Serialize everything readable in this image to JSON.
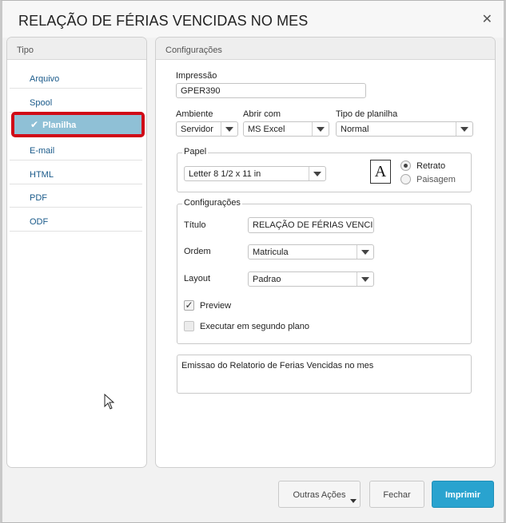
{
  "dialog": {
    "title": "RELAÇÃO DE FÉRIAS VENCIDAS NO MES",
    "close_icon": "close-icon"
  },
  "tipo": {
    "header": "Tipo",
    "items": [
      {
        "label": "Arquivo",
        "selected": false
      },
      {
        "label": "Spool",
        "selected": false
      },
      {
        "label": "Planilha",
        "selected": true
      },
      {
        "label": "E-mail",
        "selected": false
      },
      {
        "label": "HTML",
        "selected": false
      },
      {
        "label": "PDF",
        "selected": false
      },
      {
        "label": "ODF",
        "selected": false
      }
    ],
    "check_glyph": "✔"
  },
  "config": {
    "header": "Configurações",
    "impressao_label": "Impressão",
    "impressao_value": "GPER390",
    "ambiente_label": "Ambiente",
    "ambiente_value": "Servidor",
    "abrir_label": "Abrir com",
    "abrir_value": "MS Excel",
    "tipo_planilha_label": "Tipo de planilha",
    "tipo_planilha_value": "Normal",
    "papel": {
      "legend": "Papel",
      "size_value": "Letter 8 1/2 x 11 in",
      "orientation_icon_letter": "A",
      "retrato_label": "Retrato",
      "paisagem_label": "Paisagem",
      "selected": "Retrato"
    },
    "sub": {
      "legend": "Configurações",
      "titulo_label": "Título",
      "titulo_value": "RELAÇÃO DE FÉRIAS VENCIDA",
      "ordem_label": "Ordem",
      "ordem_value": "Matricula",
      "layout_label": "Layout",
      "layout_value": "Padrao",
      "preview_label": "Preview",
      "preview_checked": true,
      "segundo_plano_label": "Executar em segundo plano",
      "segundo_plano_checked": false
    },
    "description": "Emissao do Relatorio de Ferias Vencidas no mes"
  },
  "footer": {
    "outras_acoes": "Outras Ações",
    "fechar": "Fechar",
    "imprimir": "Imprimir"
  },
  "colors": {
    "accent": "#29a3cf",
    "selection": "#8fc0d6",
    "highlight_frame": "#d00a17",
    "link": "#1a5a8a"
  }
}
